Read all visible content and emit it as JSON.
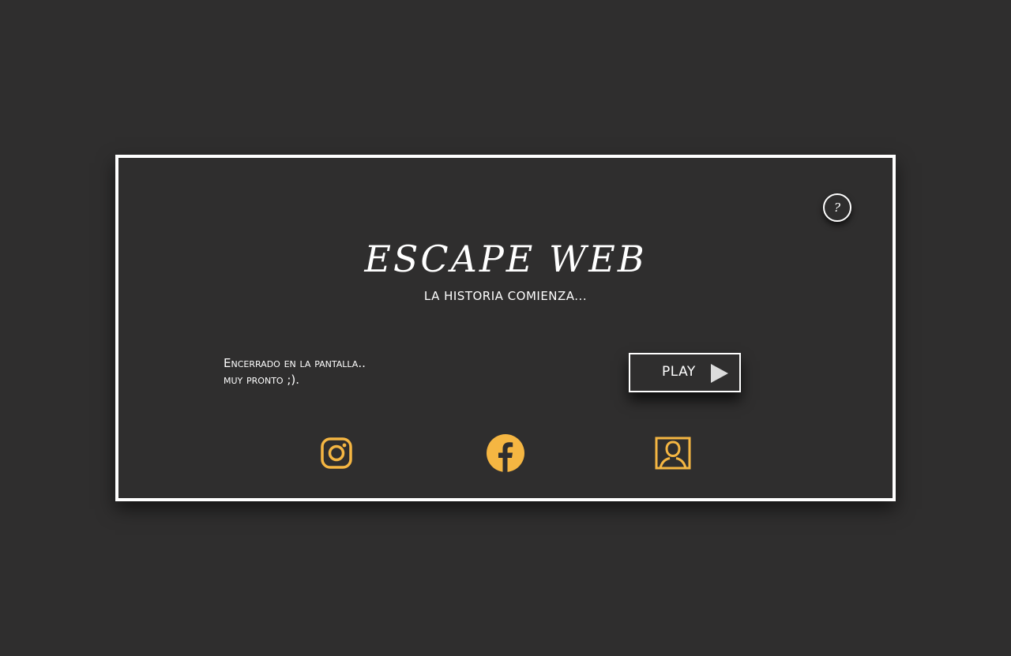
{
  "header": {
    "title": "ESCAPE WEB",
    "subtitle": "LA HISTORIA COMIENZA..."
  },
  "help": {
    "label": "?"
  },
  "intro": {
    "line1": "Encerrado en la pantalla..",
    "line2": "muy pronto ;)."
  },
  "play_button": {
    "label": "PLAY",
    "icon": "play-triangle-icon"
  },
  "social_links": [
    {
      "name": "instagram",
      "icon": "instagram-icon"
    },
    {
      "name": "facebook",
      "icon": "facebook-icon"
    },
    {
      "name": "profile",
      "icon": "user-portrait-icon"
    }
  ],
  "colors": {
    "background": "#2f2e2e",
    "border": "#ffffff",
    "accent": "#f5b642",
    "text": "#ffffff"
  }
}
